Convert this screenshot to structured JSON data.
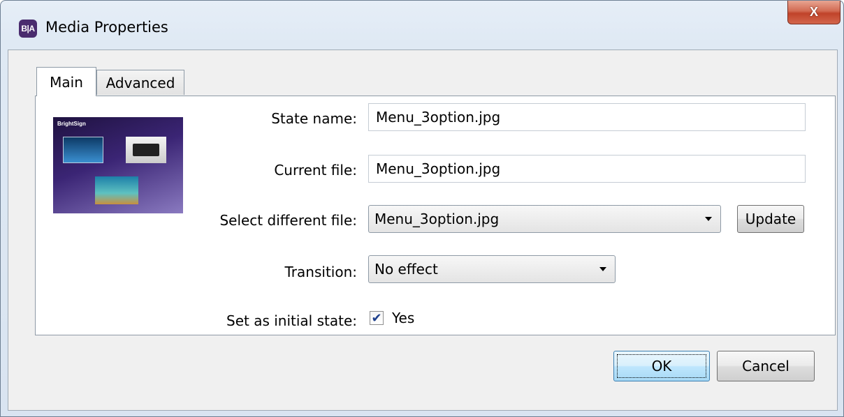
{
  "window": {
    "title": "Media Properties",
    "app_icon_text": "B|A",
    "close_symbol": "X"
  },
  "tabs": [
    {
      "label": "Main",
      "selected": true
    },
    {
      "label": "Advanced",
      "selected": false
    }
  ],
  "thumbnail": {
    "brand_text": "BrightSign"
  },
  "form": {
    "state_name": {
      "label": "State name:",
      "value": "Menu_3option.jpg"
    },
    "current_file": {
      "label": "Current file:",
      "value": "Menu_3option.jpg"
    },
    "select_file": {
      "label": "Select different file:",
      "value": "Menu_3option.jpg",
      "button": "Update"
    },
    "transition": {
      "label": "Transition:",
      "value": "No effect"
    },
    "initial_state": {
      "label": "Set as initial state:",
      "checkbox_label": "Yes",
      "checked": true
    }
  },
  "buttons": {
    "ok": "OK",
    "cancel": "Cancel"
  },
  "icons": {
    "check": "✔",
    "close": "close-icon",
    "dropdown": "chevron-down-icon"
  }
}
